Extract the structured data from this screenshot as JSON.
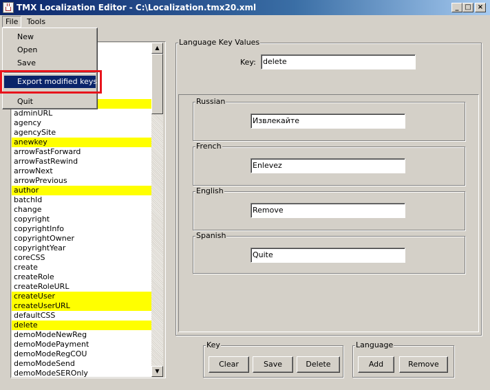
{
  "window": {
    "title": "TMX Localization Editor - C:\\Localization.tmx20.xml",
    "controls": {
      "minimize": "_",
      "maximize": "□",
      "close": "×"
    }
  },
  "menubar": {
    "file": "File",
    "tools": "Tools"
  },
  "file_menu": {
    "items": [
      "New",
      "Open",
      "Save",
      "Export modified keys",
      "Quit"
    ],
    "selected": "Export modified keys"
  },
  "keys_list": {
    "items": [
      {
        "label": "adminURL",
        "modified": false
      },
      {
        "label": "agency",
        "modified": false
      },
      {
        "label": "agencySite",
        "modified": false
      },
      {
        "label": "anewkey",
        "modified": true
      },
      {
        "label": "arrowFastForward",
        "modified": false
      },
      {
        "label": "arrowFastRewind",
        "modified": false
      },
      {
        "label": "arrowNext",
        "modified": false
      },
      {
        "label": "arrowPrevious",
        "modified": false
      },
      {
        "label": "author",
        "modified": true
      },
      {
        "label": "batchId",
        "modified": false
      },
      {
        "label": "change",
        "modified": false
      },
      {
        "label": "copyright",
        "modified": false
      },
      {
        "label": "copyrightInfo",
        "modified": false
      },
      {
        "label": "copyrightOwner",
        "modified": false
      },
      {
        "label": "copyrightYear",
        "modified": false
      },
      {
        "label": "coreCSS",
        "modified": false
      },
      {
        "label": "create",
        "modified": false
      },
      {
        "label": "createRole",
        "modified": false
      },
      {
        "label": "createRoleURL",
        "modified": false
      },
      {
        "label": "createUser",
        "modified": true
      },
      {
        "label": "createUserURL",
        "modified": true
      },
      {
        "label": "defaultCSS",
        "modified": false
      },
      {
        "label": "delete",
        "modified": true
      },
      {
        "label": "demoModeNewReg",
        "modified": false
      },
      {
        "label": "demoModePayment",
        "modified": false
      },
      {
        "label": "demoModeRegCOU",
        "modified": false
      },
      {
        "label": "demoModeSend",
        "modified": false
      },
      {
        "label": "demoModeSEROnly",
        "modified": false
      }
    ],
    "highlight_color": "#ffff00",
    "scroll_up": "▲",
    "scroll_down": "▼"
  },
  "values_panel": {
    "title": "Language Key Values",
    "key_label": "Key:",
    "key_value": "delete",
    "languages": [
      {
        "name": "Russian",
        "value": "Извлекайте"
      },
      {
        "name": "French",
        "value": "Enlevez"
      },
      {
        "name": "English",
        "value": "Remove"
      },
      {
        "name": "Spanish",
        "value": "Quite"
      }
    ]
  },
  "key_group": {
    "title": "Key",
    "buttons": [
      "Clear",
      "Save",
      "Delete"
    ]
  },
  "language_group": {
    "title": "Language",
    "buttons": [
      "Add",
      "Remove"
    ]
  },
  "colors": {
    "title_bar_start": "#0a246a",
    "menu_selection": "#0a246a",
    "annotation_box": "#e8141c"
  }
}
